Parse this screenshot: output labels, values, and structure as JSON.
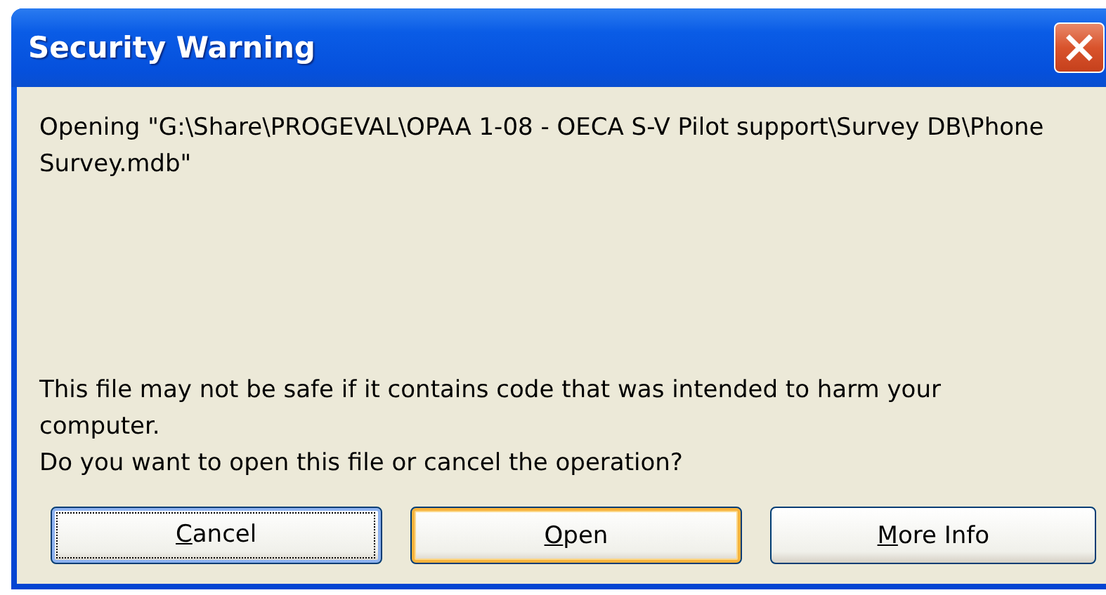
{
  "window": {
    "title": "Security Warning"
  },
  "message": {
    "file_line": "Opening \"G:\\Share\\PROGEVAL\\OPAA 1-08 - OECA S-V Pilot support\\Survey DB\\Phone Survey.mdb\"",
    "warning_lines": [
      "This file may not be safe if it contains code that was intended to harm your computer.",
      "Do you want to open this file or cancel the operation?"
    ]
  },
  "buttons": [
    {
      "mnemonic": "C",
      "label_rest": "ancel",
      "focused": true,
      "default": false
    },
    {
      "mnemonic": "O",
      "label_rest": "pen",
      "focused": false,
      "default": true
    },
    {
      "mnemonic": "M",
      "label_rest": "ore Info",
      "focused": false,
      "default": false
    }
  ]
}
